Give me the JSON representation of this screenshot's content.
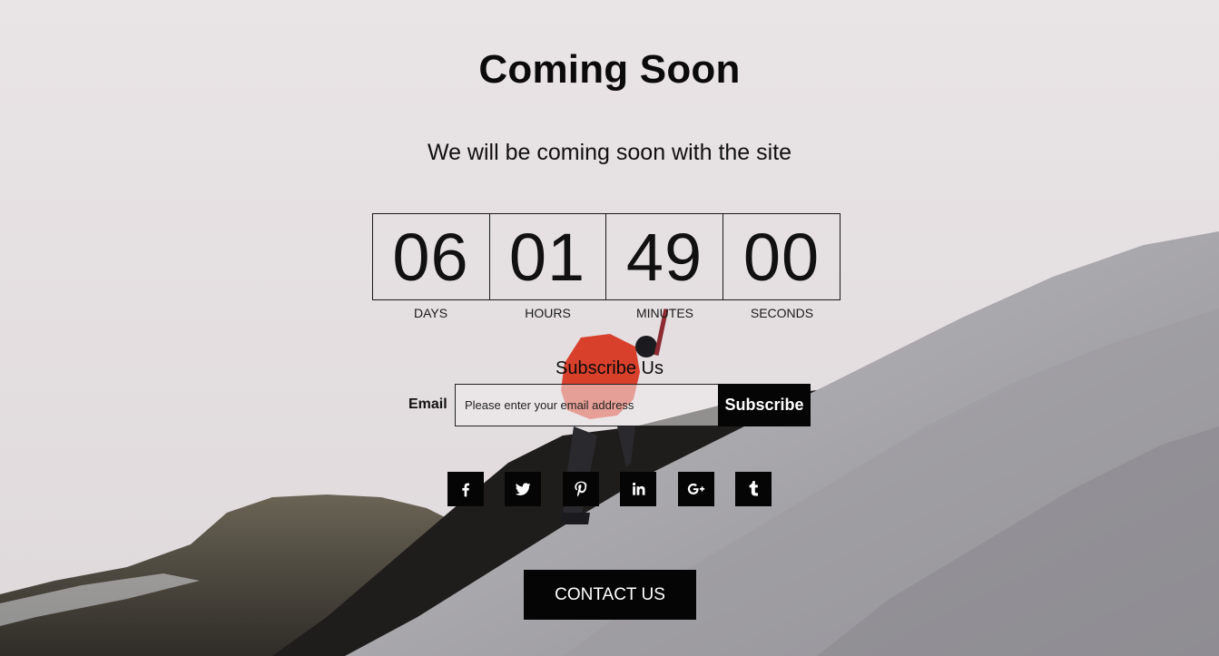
{
  "header": {
    "title": "Coming Soon",
    "subtitle": "We will be coming soon with the site"
  },
  "countdown": [
    {
      "value": "06",
      "label": "DAYS"
    },
    {
      "value": "01",
      "label": "HOURS"
    },
    {
      "value": "49",
      "label": "MINUTES"
    },
    {
      "value": "00",
      "label": "SECONDS"
    }
  ],
  "subscribe": {
    "title": "Subscribe Us",
    "email_label": "Email",
    "placeholder": "Please enter your email address",
    "button_label": "Subscribe"
  },
  "socials": [
    {
      "name": "facebook",
      "icon": "facebook-icon"
    },
    {
      "name": "twitter",
      "icon": "twitter-icon"
    },
    {
      "name": "pinterest",
      "icon": "pinterest-icon"
    },
    {
      "name": "linkedin",
      "icon": "linkedin-icon"
    },
    {
      "name": "google-plus",
      "icon": "google-plus-icon"
    },
    {
      "name": "tumblr",
      "icon": "tumblr-icon"
    }
  ],
  "contact": {
    "button_label": "CONTACT US"
  },
  "colors": {
    "background": "#e6e0e2",
    "button": "#050505",
    "text": "#0b0b0b",
    "climber_jacket": "#d9402c"
  }
}
